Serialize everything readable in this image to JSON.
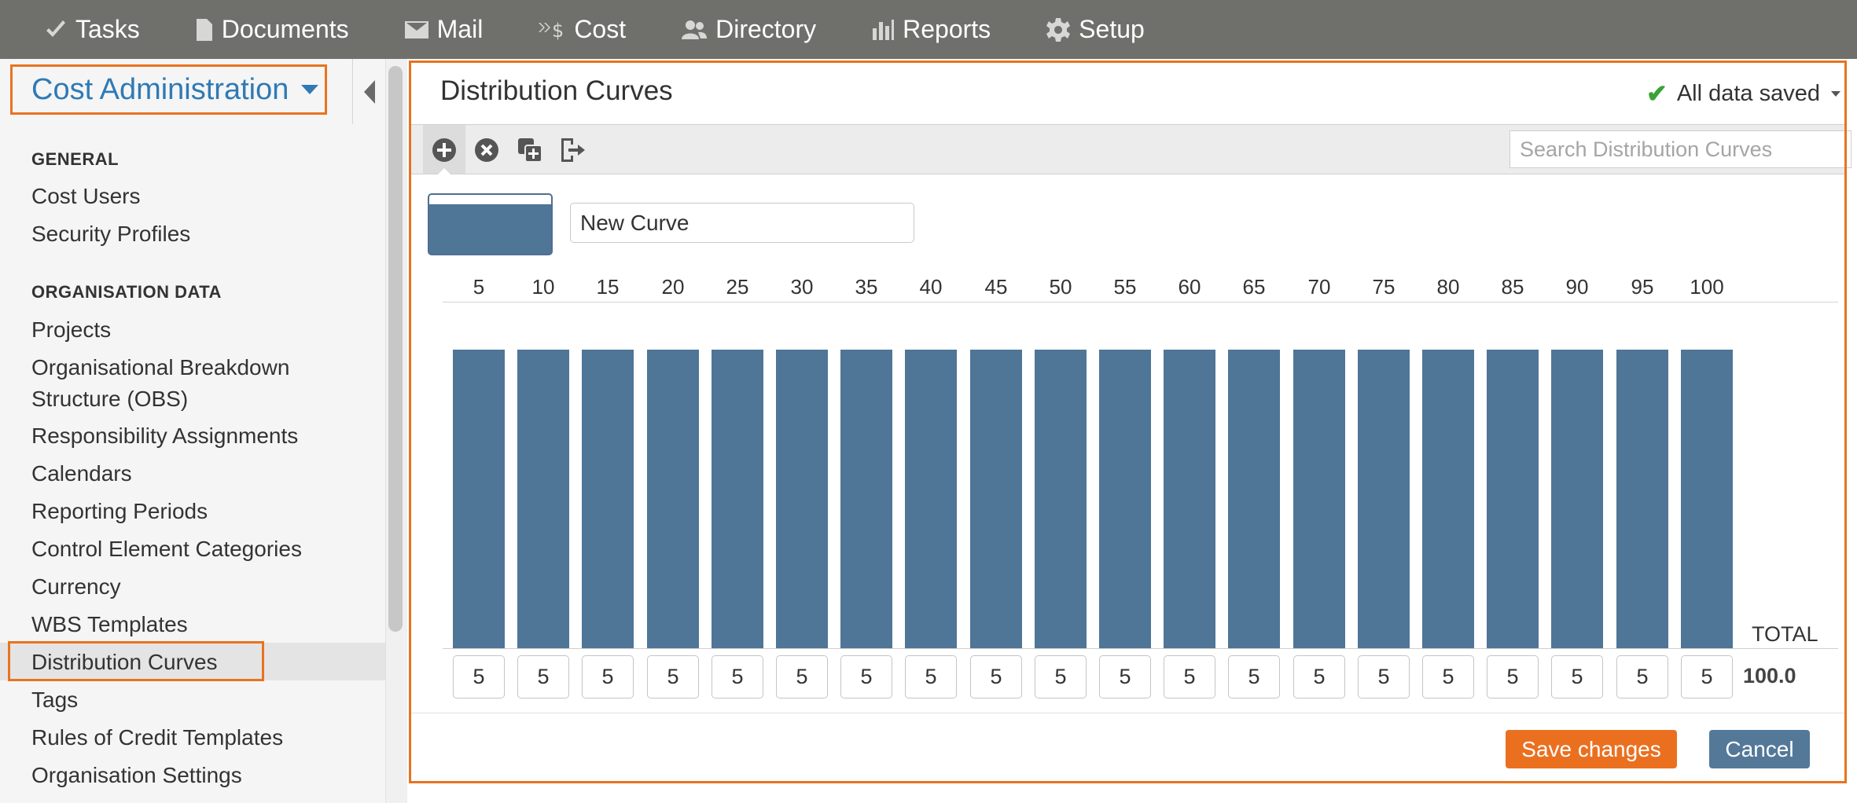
{
  "topnav": {
    "items": [
      {
        "label": "Tasks",
        "icon": "check-icon"
      },
      {
        "label": "Documents",
        "icon": "document-icon"
      },
      {
        "label": "Mail",
        "icon": "envelope-icon"
      },
      {
        "label": "Cost",
        "icon": "cost-icon"
      },
      {
        "label": "Directory",
        "icon": "people-icon"
      },
      {
        "label": "Reports",
        "icon": "bar-chart-icon"
      },
      {
        "label": "Setup",
        "icon": "gear-icon"
      }
    ]
  },
  "sidebar": {
    "module_title": "Cost Administration",
    "sections": [
      {
        "heading": "GENERAL",
        "items": [
          {
            "label": "Cost Users"
          },
          {
            "label": "Security Profiles"
          }
        ]
      },
      {
        "heading": "ORGANISATION DATA",
        "items": [
          {
            "label": "Projects"
          },
          {
            "label": "Organisational Breakdown Structure (OBS)"
          },
          {
            "label": "Responsibility Assignments"
          },
          {
            "label": "Calendars"
          },
          {
            "label": "Reporting Periods"
          },
          {
            "label": "Control Element Categories"
          },
          {
            "label": "Currency"
          },
          {
            "label": "WBS Templates"
          },
          {
            "label": "Distribution Curves",
            "active": true
          },
          {
            "label": "Tags"
          },
          {
            "label": "Rules of Credit Templates"
          },
          {
            "label": "Organisation Settings"
          }
        ]
      }
    ]
  },
  "main": {
    "title": "Distribution Curves",
    "save_status": "All data saved",
    "toolbar": {
      "icons": [
        "add-icon",
        "delete-icon",
        "duplicate-icon",
        "export-icon"
      ]
    },
    "search": {
      "placeholder": "Search Distribution Curves",
      "value": ""
    },
    "curve": {
      "name": "New Curve",
      "color": "#4f7597"
    },
    "total_label": "TOTAL",
    "total_value": "100.0",
    "save_label": "Save changes",
    "cancel_label": "Cancel"
  },
  "chart_data": {
    "type": "bar",
    "categories": [
      "5",
      "10",
      "15",
      "20",
      "25",
      "30",
      "35",
      "40",
      "45",
      "50",
      "55",
      "60",
      "65",
      "70",
      "75",
      "80",
      "85",
      "90",
      "95",
      "100"
    ],
    "values": [
      5,
      5,
      5,
      5,
      5,
      5,
      5,
      5,
      5,
      5,
      5,
      5,
      5,
      5,
      5,
      5,
      5,
      5,
      5,
      5
    ],
    "title": "",
    "xlabel": "",
    "ylabel": "",
    "ylim": [
      0,
      5.5
    ],
    "bar_color": "#4f7597",
    "grid": false
  },
  "colors": {
    "accent_orange": "#e8731f",
    "link_blue": "#2f7ab5",
    "nav_bg": "#6f706b",
    "saved_green": "#3aa336"
  }
}
